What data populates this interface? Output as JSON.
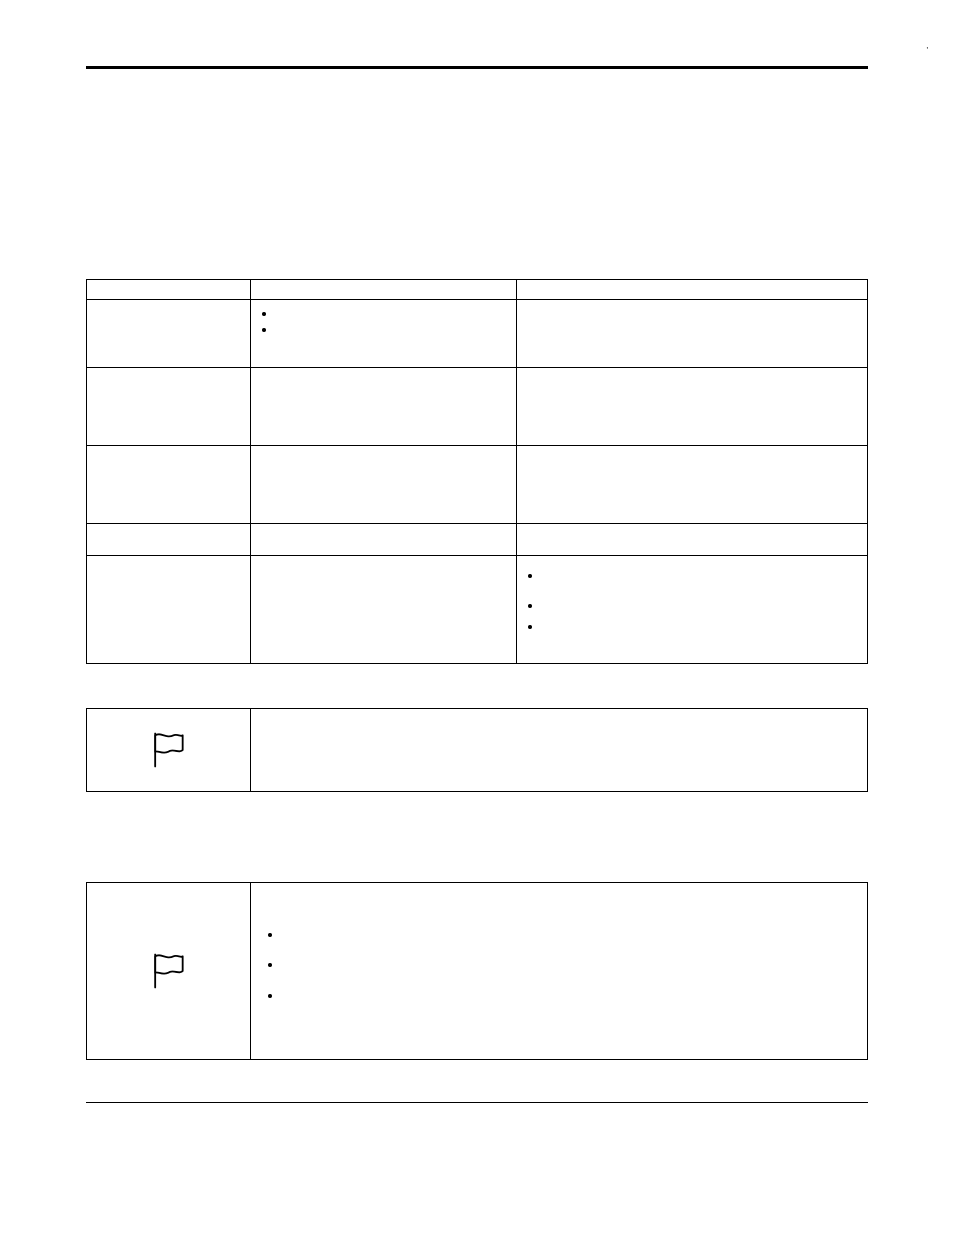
{
  "page": {
    "top_right_mark": "'"
  },
  "table": {
    "header": {
      "c1": "",
      "c2": "",
      "c3": ""
    },
    "rows": [
      {
        "c1": "",
        "c2_bullets": [
          "",
          ""
        ],
        "c3": ""
      },
      {
        "c1": "",
        "c2": "",
        "c3": ""
      },
      {
        "c1": "",
        "c2": "",
        "c3": ""
      },
      {
        "c1": "",
        "c2": "",
        "c3": ""
      },
      {
        "c1": "",
        "c2": "",
        "c3_bullets": [
          "",
          "",
          ""
        ]
      }
    ]
  },
  "callouts": [
    {
      "icon": "flag-icon",
      "body": ""
    },
    {
      "icon": "flag-icon",
      "body_lead": "",
      "bullets": [
        "",
        "",
        ""
      ]
    }
  ]
}
